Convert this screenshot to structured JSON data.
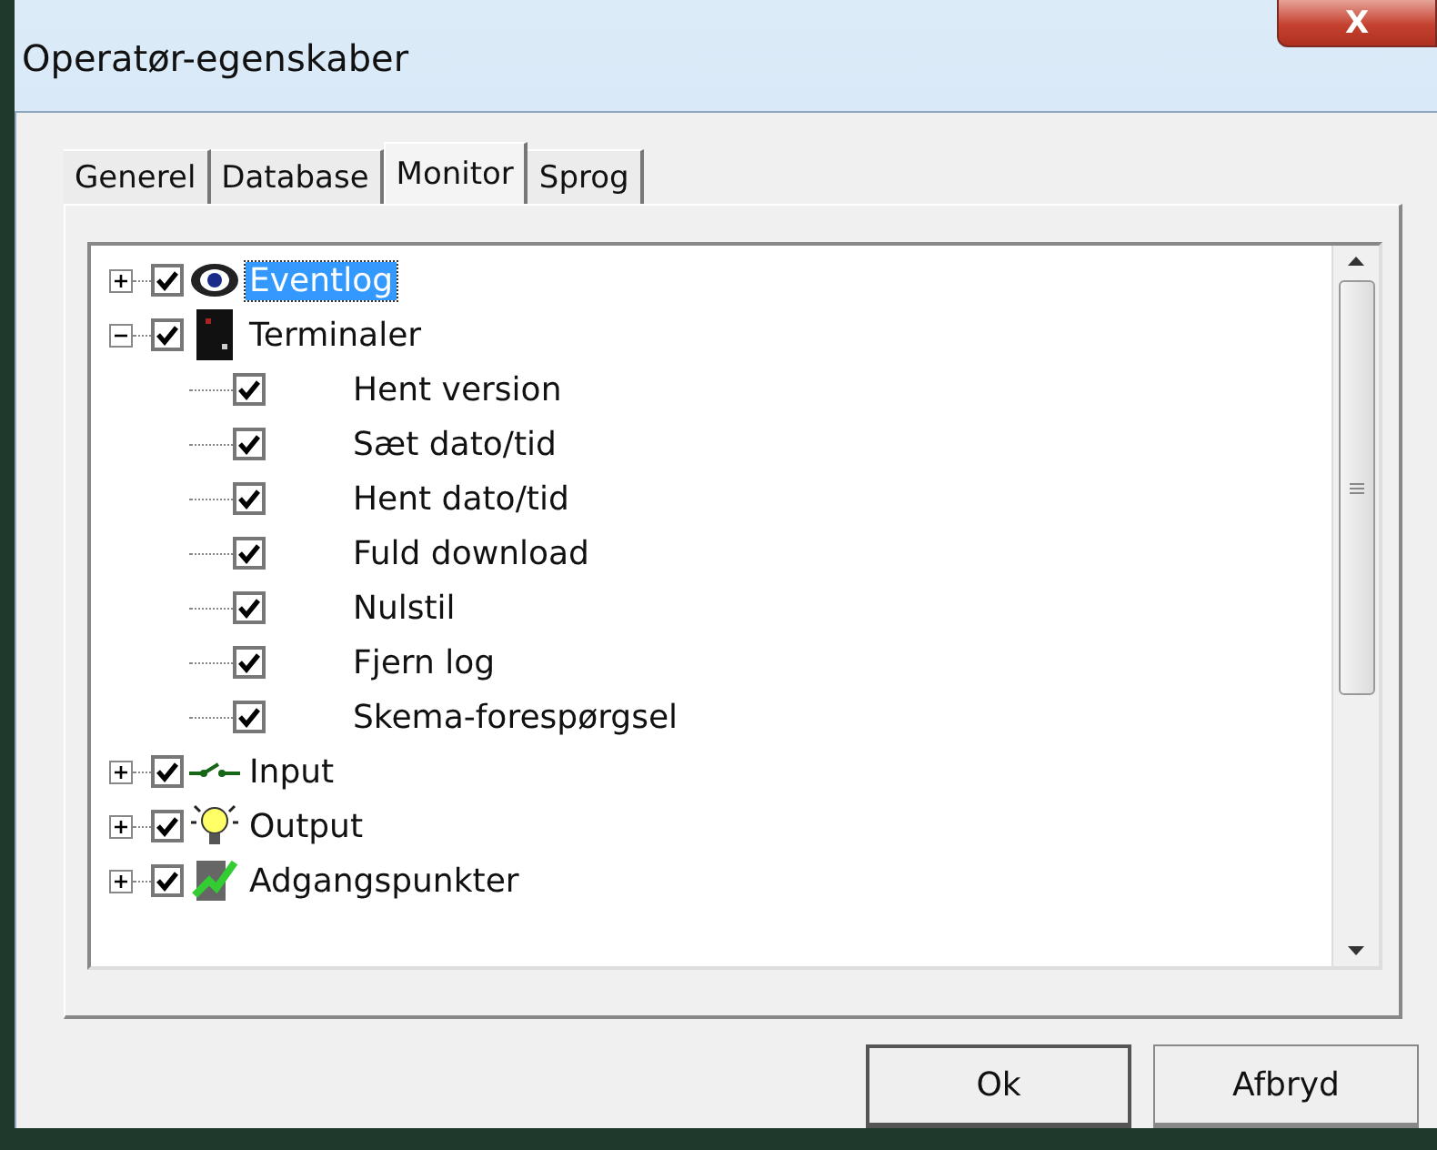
{
  "window": {
    "title": "Operatør-egenskaber",
    "close_symbol": "X"
  },
  "tabs": [
    {
      "label": "Generel",
      "selected": false
    },
    {
      "label": "Database",
      "selected": false
    },
    {
      "label": "Monitor",
      "selected": true
    },
    {
      "label": "Sprog",
      "selected": false
    }
  ],
  "tree": [
    {
      "label": "Eventlog",
      "checked": true,
      "expanded": false,
      "selected": true
    },
    {
      "label": "Terminaler",
      "checked": true,
      "expanded": true,
      "selected": false,
      "children": [
        {
          "label": "Hent version",
          "checked": true,
          "selected": false
        },
        {
          "label": "Sæt dato/tid",
          "checked": true,
          "selected": false
        },
        {
          "label": "Hent dato/tid",
          "checked": true,
          "selected": false
        },
        {
          "label": "Fuld download",
          "checked": true,
          "selected": false
        },
        {
          "label": "Nulstil",
          "checked": true,
          "selected": false
        },
        {
          "label": "Fjern log",
          "checked": true,
          "selected": false
        },
        {
          "label": "Skema-forespørgsel",
          "checked": true,
          "selected": false
        }
      ]
    },
    {
      "label": "Input",
      "checked": true,
      "expanded": false,
      "selected": false
    },
    {
      "label": "Output",
      "checked": true,
      "expanded": false,
      "selected": false
    },
    {
      "label": "Adgangspunkter",
      "checked": true,
      "expanded": false,
      "selected": false
    }
  ],
  "buttons": [
    {
      "label": "Ok",
      "default": true
    },
    {
      "label": "Afbryd",
      "default": false
    }
  ]
}
